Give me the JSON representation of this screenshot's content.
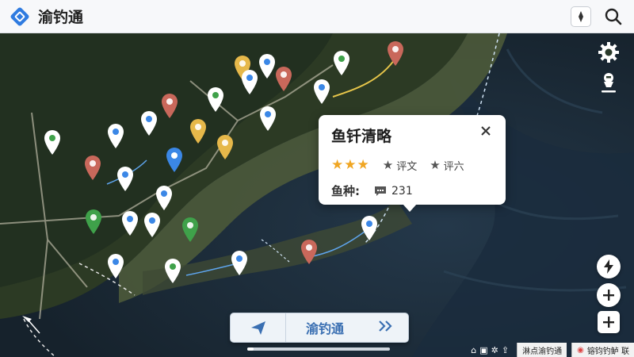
{
  "app": {
    "title": "渝钓通"
  },
  "info_card": {
    "title": "鱼钎清略",
    "stars": "★★★",
    "review_a": "评文",
    "review_b": "评六",
    "species_label": "鱼种:",
    "comment_count": "231"
  },
  "nav": {
    "label": "渝钓通",
    "next_label": "»"
  },
  "attribution": {
    "left_text": "淋点渝钓通",
    "right_text": "镕钧钓鲈 联"
  },
  "colors": {
    "blue": "#3b87e6",
    "green": "#3fa14a",
    "red": "#c9685b",
    "yellow": "#e6b84a",
    "accent": "#2f7be0"
  }
}
